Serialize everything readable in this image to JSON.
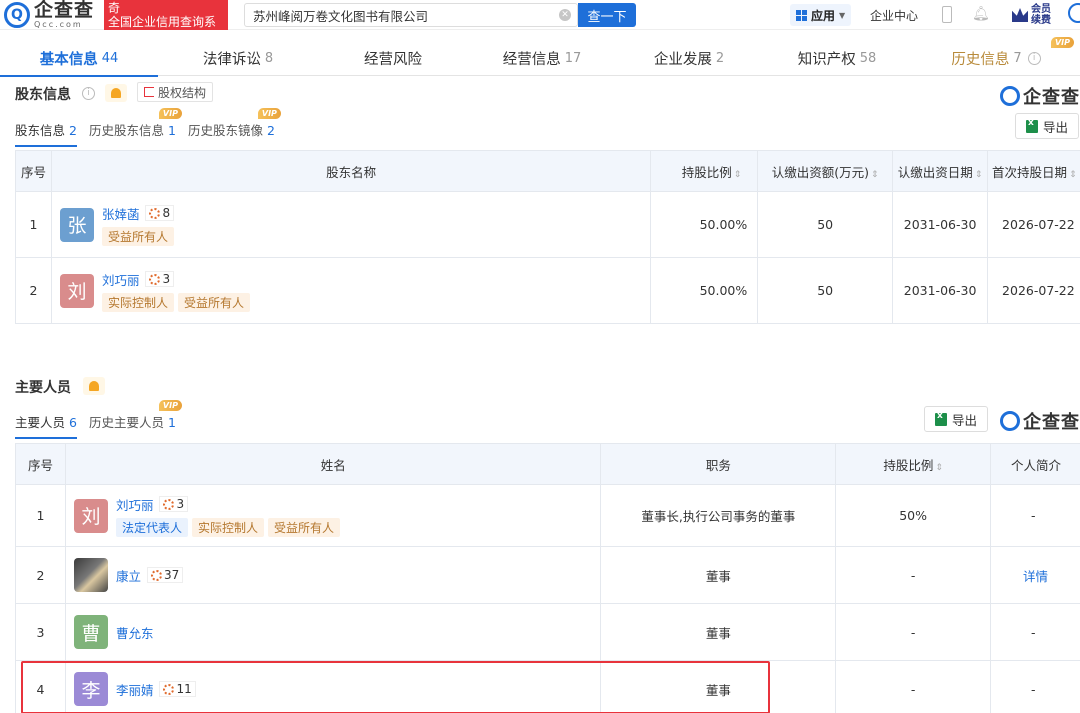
{
  "header": {
    "logo_cn": "企查查",
    "logo_en": "Qcc.com",
    "ribbon_line1": "奇",
    "ribbon_line2": "全国企业信用查询系",
    "search_value": "苏州峰阅万卷文化图书有限公司",
    "search_button": "查一下",
    "app_label": "应用",
    "center_link": "企业中心",
    "vip_renew_line1": "会员",
    "vip_renew_line2": "续费"
  },
  "tabs": [
    {
      "label": "基本信息",
      "count": "44"
    },
    {
      "label": "法律诉讼",
      "count": "8"
    },
    {
      "label": "经营风险",
      "count": ""
    },
    {
      "label": "经营信息",
      "count": "17"
    },
    {
      "label": "企业发展",
      "count": "2"
    },
    {
      "label": "知识产权",
      "count": "58"
    },
    {
      "label": "历史信息",
      "count": "7",
      "vip": "VIP"
    }
  ],
  "shareholders": {
    "title": "股东信息",
    "structure_button": "股权结构",
    "subtabs": [
      {
        "label": "股东信息",
        "count": "2"
      },
      {
        "label": "历史股东信息",
        "count": "1",
        "vip": "VIP"
      },
      {
        "label": "历史股东镜像",
        "count": "2",
        "vip": "VIP"
      }
    ],
    "brand": "企查查",
    "export": "导出",
    "columns": [
      "序号",
      "股东名称",
      "持股比例",
      "认缴出资额(万元)",
      "认缴出资日期",
      "首次持股日期"
    ],
    "rows": [
      {
        "index": "1",
        "avatar": "张",
        "name": "张婞菡",
        "rel": "8",
        "tags": [
          "受益所有人"
        ],
        "ratio": "50.00%",
        "amount": "50",
        "date": "2031-06-30",
        "first": "2026-07-22"
      },
      {
        "index": "2",
        "avatar": "刘",
        "name": "刘巧丽",
        "rel": "3",
        "tags": [
          "实际控制人",
          "受益所有人"
        ],
        "ratio": "50.00%",
        "amount": "50",
        "date": "2031-06-30",
        "first": "2026-07-22"
      }
    ]
  },
  "personnel": {
    "title": "主要人员",
    "subtabs": [
      {
        "label": "主要人员",
        "count": "6"
      },
      {
        "label": "历史主要人员",
        "count": "1",
        "vip": "VIP"
      }
    ],
    "export": "导出",
    "brand": "企查查",
    "columns": [
      "序号",
      "姓名",
      "职务",
      "持股比例",
      "个人简介"
    ],
    "rows": [
      {
        "index": "1",
        "avatar": "刘",
        "name": "刘巧丽",
        "rel": "3",
        "tags": [
          "法定代表人",
          "实际控制人",
          "受益所有人"
        ],
        "title": "董事长,执行公司事务的董事",
        "ratio": "50%",
        "bio": "-"
      },
      {
        "index": "2",
        "avatar": "",
        "name": "康立",
        "rel": "37",
        "tags": [],
        "title": "董事",
        "ratio": "-",
        "bio": "详情"
      },
      {
        "index": "3",
        "avatar": "曹",
        "name": "曹允东",
        "rel": "",
        "tags": [],
        "title": "董事",
        "ratio": "-",
        "bio": "-"
      },
      {
        "index": "4",
        "avatar": "李",
        "name": "李丽婧",
        "rel": "11",
        "tags": [],
        "title": "董事",
        "ratio": "-",
        "bio": "-"
      }
    ]
  },
  "colors": {
    "primary": "#1e6fd9",
    "danger": "#e8333c",
    "avatar_zhang": "#6c9fd0",
    "avatar_liu": "#d98c8c",
    "avatar_cao": "#7fb37a",
    "avatar_li": "#9b8ad6"
  }
}
